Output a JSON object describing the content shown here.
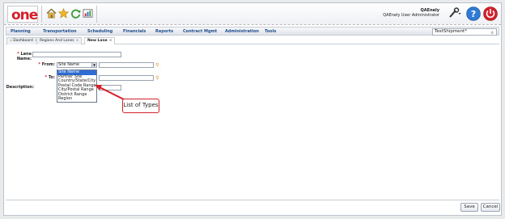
{
  "header": {
    "logo_text": "one",
    "user_name": "QAEnely",
    "user_role": "QAEnely User Administrator"
  },
  "nav": {
    "items": [
      "Planning",
      "Transportation",
      "Scheduling",
      "Financials",
      "Reports",
      "Contract Mgmt",
      "Administration",
      "Tools"
    ],
    "search_value": "TestShipment*"
  },
  "tabs": [
    {
      "label": "Dashboard",
      "close": "×"
    },
    {
      "label": "Regions And Lanes",
      "close": "×"
    },
    {
      "label": "New Lane",
      "close": "×"
    }
  ],
  "form": {
    "lane_name_label": "Lane Name:",
    "from_label": "From:",
    "to_label": "To:",
    "description_label": "Description:",
    "from_selected": "Site Name",
    "required_mark": "*"
  },
  "dropdown": {
    "options": [
      "Site Name",
      "Partner Site",
      "Country/State/City",
      "Postal Code Range",
      "City/Postal Range",
      "District Range",
      "Region"
    ],
    "selected_index": 0
  },
  "annotation": {
    "callout_text": "List of Types",
    "arrow_color": "#d4202a"
  },
  "buttons": {
    "save": "Save",
    "cancel": "Cancel"
  },
  "colors": {
    "brand_red": "#d4202a",
    "nav_text": "#1f4e8c",
    "selection": "#2e6cd4"
  }
}
